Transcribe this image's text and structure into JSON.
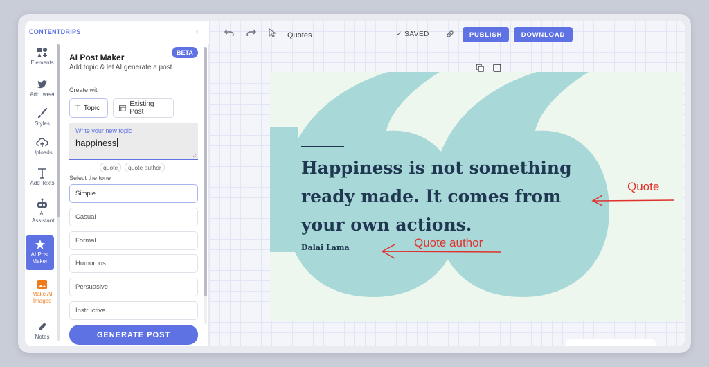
{
  "brand": "CONTENTDRIPS",
  "rail": {
    "items": [
      {
        "label": "Elements"
      },
      {
        "label": "Add tweet"
      },
      {
        "label": "Styles"
      },
      {
        "label": "Uploads"
      },
      {
        "label": "Add Texts"
      },
      {
        "label": "AI Assistant"
      },
      {
        "label": "AI Post Maker"
      },
      {
        "label": "Make AI Images"
      },
      {
        "label": "Notes"
      }
    ]
  },
  "panel": {
    "title": "AI Post Maker",
    "subtitle": "Add topic & let AI generate a post",
    "badge": "BETA",
    "create_with_label": "Create with",
    "option_topic": "Topic",
    "option_existing": "Existing Post",
    "topic_placeholder": "Write your new topic",
    "topic_value": "happiness",
    "tags": [
      "quote",
      "quote author"
    ],
    "tone_label": "Select the tone",
    "tones": [
      "Simple",
      "Casual",
      "Formal",
      "Humorous",
      "Persuasive",
      "Instructive"
    ],
    "selected_tone": "Simple",
    "generate_label": "GENERATE POST"
  },
  "toolbar": {
    "title": "Quotes",
    "saved": "SAVED",
    "publish": "PUBLISH",
    "download": "DOWNLOAD"
  },
  "post": {
    "quote_lines": [
      "Happiness is not something",
      "ready made. It comes from",
      "your own actions."
    ],
    "author": "Dalai Lama"
  },
  "annotations": {
    "quote": "Quote",
    "author": "Quote author"
  },
  "colors": {
    "accent": "#5e72e4",
    "quote_mark": "#a8d8d8",
    "post_text": "#1f3750",
    "annotation": "#e0322d",
    "ai_images": "#f07a1a"
  }
}
